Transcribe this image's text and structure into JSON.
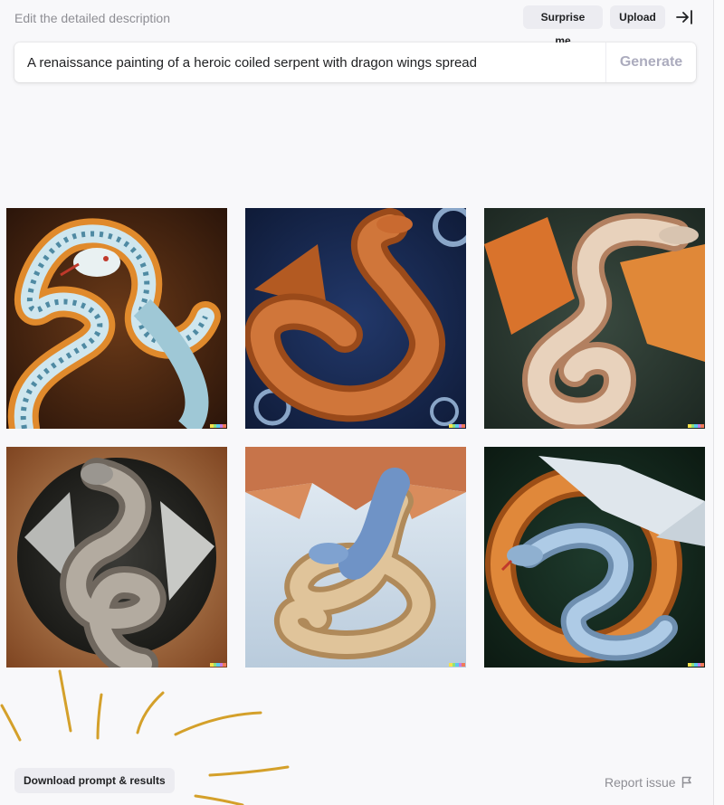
{
  "header": {
    "hint": "Edit the detailed description",
    "surprise_label": "Surprise me",
    "upload_label": "Upload",
    "collapse_icon": "collapse-right-icon"
  },
  "prompt": {
    "value": "A renaissance painting of a heroic coiled serpent with dragon wings spread",
    "generate_label": "Generate"
  },
  "results": [
    {
      "subject": "blue-gold serpent on brown background"
    },
    {
      "subject": "copper winged dragon on dark blue swirls"
    },
    {
      "subject": "pale serpent with orange wings on dark green"
    },
    {
      "subject": "grey coiled dragon in circular frame"
    },
    {
      "subject": "blue and gold serpent with red wings on sky"
    },
    {
      "subject": "blue dragon with white wings in orange ring"
    }
  ],
  "footer": {
    "download_label": "Download prompt & results",
    "report_label": "Report issue",
    "report_icon": "flag-icon"
  },
  "colors": {
    "accent_spark": "#d4a02a",
    "signature": [
      "#f6e14b",
      "#8fe27a",
      "#5ac9f0",
      "#c47be6",
      "#f07a5a"
    ]
  }
}
